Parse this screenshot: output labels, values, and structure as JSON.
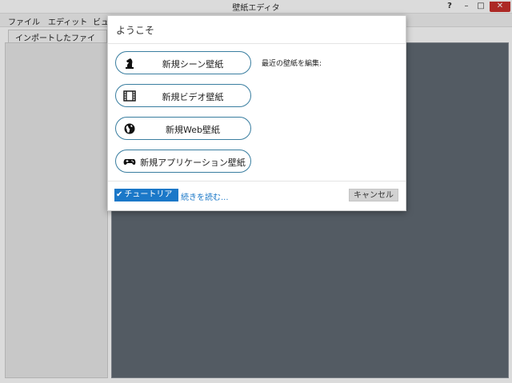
{
  "window": {
    "title": "壁紙エディタ",
    "help": "?",
    "minimize": "–",
    "maximize": "□",
    "close": "✕"
  },
  "menu": [
    "ファイル",
    "エディット",
    "ビュ"
  ],
  "tabs": [
    {
      "label": "インポートしたファイル"
    }
  ],
  "dialog": {
    "title": "ようこそ",
    "buttons": [
      {
        "label": "新規シーン壁紙",
        "icon": "chess-knight-icon"
      },
      {
        "label": "新規ビデオ壁紙",
        "icon": "film-icon"
      },
      {
        "label": "新規Web壁紙",
        "icon": "globe-icon"
      },
      {
        "label": "新規アプリケーション壁紙",
        "icon": "gamepad-icon"
      }
    ],
    "recent_label": "最近の壁紙を編集:",
    "tutorial_checkbox": "チュートリアル",
    "tutorial_checked": true,
    "read_more": "続きを読む...",
    "cancel": "キャンセル"
  },
  "colors": {
    "accent": "#1b78c8",
    "pill_border": "#3a7ea0",
    "workspace": "#616a74",
    "close_button": "#c9302c"
  }
}
